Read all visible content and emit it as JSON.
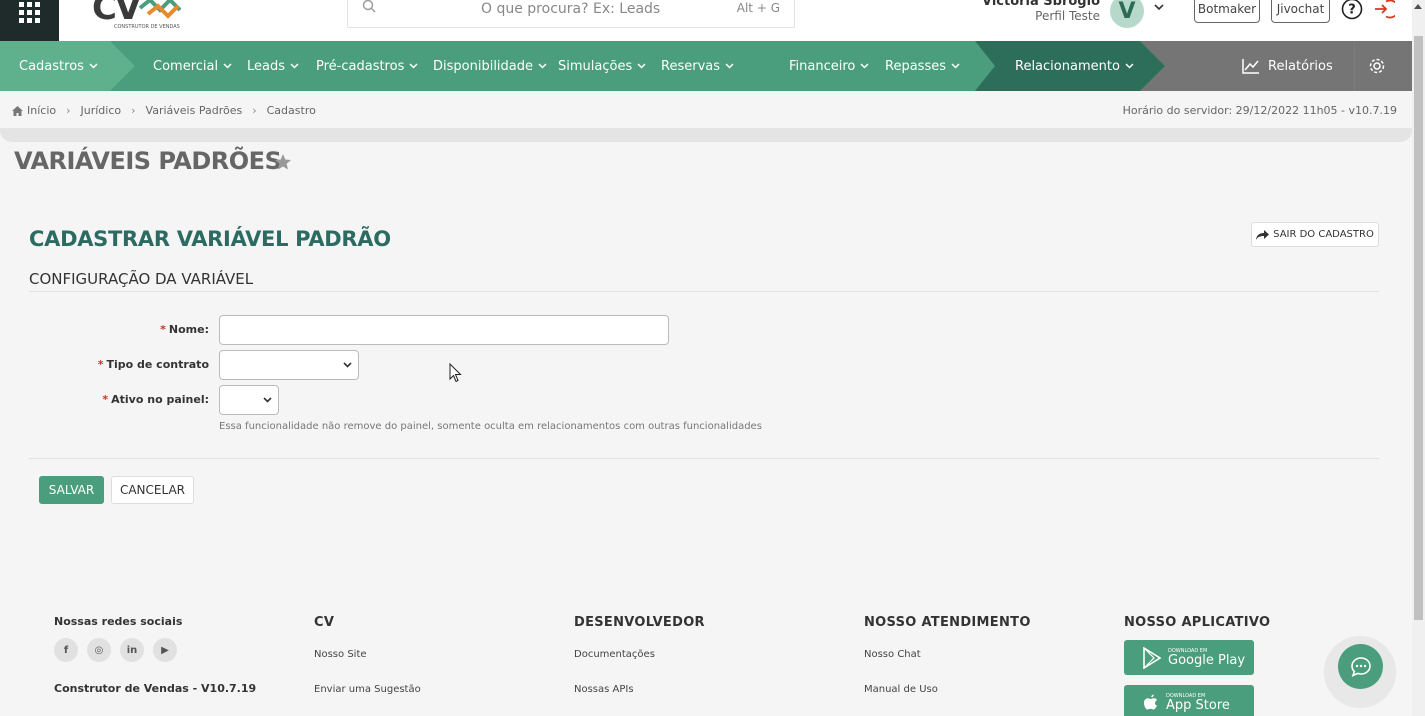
{
  "header": {
    "logo_text": "CV",
    "logo_sub": "CONSTRUTOR DE VENDAS",
    "search_placeholder": "O que procura? Ex: Leads",
    "search_shortcut": "Alt + G",
    "user_name": "Victoria Sbrogio",
    "user_profile": "Perfil Teste",
    "avatar_initial": "V",
    "botmaker_label": "Botmaker",
    "jivochat_label": "Jivochat"
  },
  "nav": {
    "items": [
      {
        "label": "Cadastros"
      },
      {
        "label": "Comercial"
      },
      {
        "label": "Leads"
      },
      {
        "label": "Pré-cadastros"
      },
      {
        "label": "Disponibilidade"
      },
      {
        "label": "Simulações"
      },
      {
        "label": "Reservas"
      },
      {
        "label": "Financeiro"
      },
      {
        "label": "Repasses"
      },
      {
        "label": "Relacionamento"
      }
    ],
    "reports_label": "Relatórios",
    "colors": {
      "primary": "#4a9e7d",
      "light": "#5fb08c",
      "dark": "#2d6e5a",
      "gray": "#757575"
    }
  },
  "breadcrumb": {
    "items": [
      "Início",
      "Jurídico",
      "Variáveis Padrões",
      "Cadastro"
    ],
    "server_time": "Horário do servidor: 29/12/2022 11h05 - v10.7.19"
  },
  "page": {
    "title": "VARIÁVEIS PADRÕES",
    "form_title": "CADASTRAR VARIÁVEL PADRÃO",
    "exit_label": "SAIR DO CADASTRO",
    "section_title": "CONFIGURAÇÃO DA VARIÁVEL",
    "fields": {
      "required_mark": "*",
      "name_label": "Nome:",
      "contract_label": "Tipo de contrato",
      "active_label": "Ativo no painel:",
      "active_help": "Essa funcionalidade não remove do painel, somente oculta em relacionamentos com outras funcionalidades"
    },
    "save_label": "SALVAR",
    "cancel_label": "CANCELAR"
  },
  "footer": {
    "social_title": "Nossas redes sociais",
    "social_icons": [
      "f",
      "◎",
      "in",
      "▶"
    ],
    "version": "Construtor de Vendas - V10.7.19",
    "cv_title": "CV",
    "cv_links": [
      "Nosso Site",
      "Enviar uma Sugestão"
    ],
    "dev_title": "DESENVOLVEDOR",
    "dev_links": [
      "Documentações",
      "Nossas APIs"
    ],
    "support_title": "NOSSO ATENDIMENTO",
    "support_links": [
      "Nosso Chat",
      "Manual de Uso"
    ],
    "app_title": "NOSSO APLICATIVO",
    "google_small": "DOWNLOAD EM",
    "google_big": "Google Play",
    "apple_small": "DOWNLOAD EM",
    "apple_big": "App Store"
  }
}
